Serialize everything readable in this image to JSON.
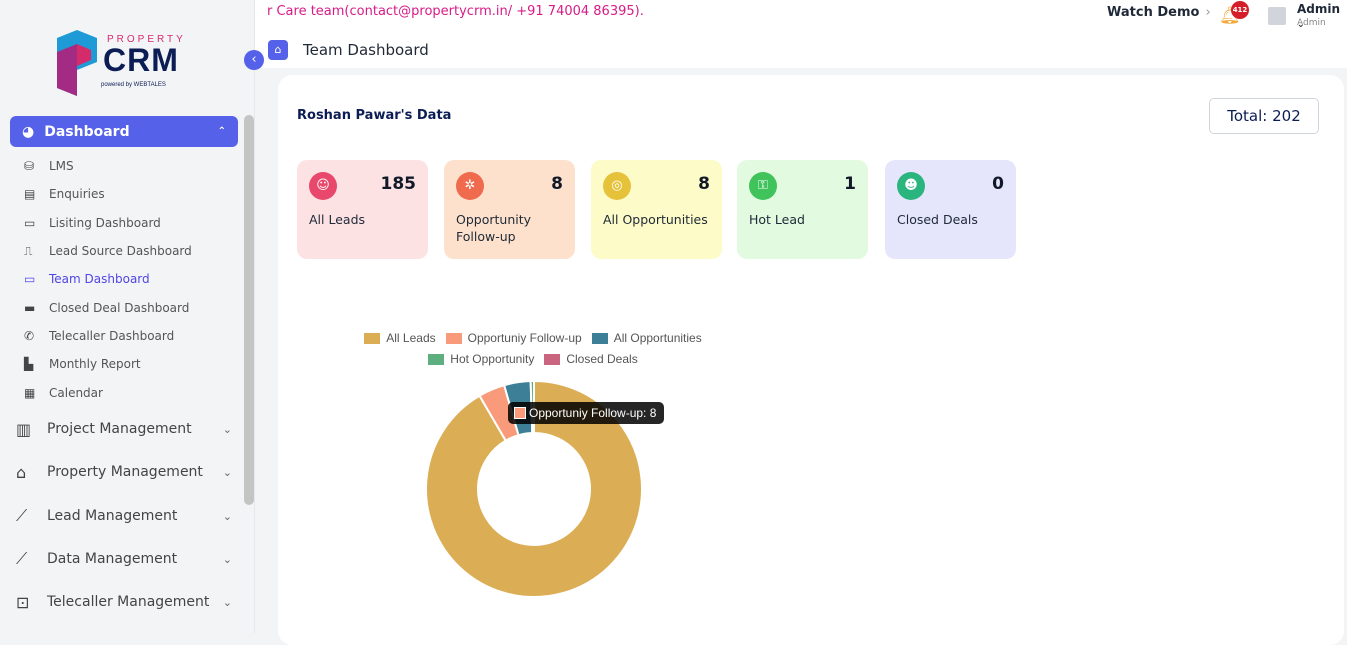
{
  "brand": {
    "top_text": "PROPERTY",
    "name": "CRM",
    "powered_by": "powered by WEBTALES"
  },
  "sidebar": {
    "dashboard_label": "Dashboard",
    "sub_items": [
      {
        "label": "LMS",
        "icon": "database-icon"
      },
      {
        "label": "Enquiries",
        "icon": "document-icon"
      },
      {
        "label": "Lisiting Dashboard",
        "icon": "monitor-icon"
      },
      {
        "label": "Lead Source Dashboard",
        "icon": "tv-icon"
      },
      {
        "label": "Team Dashboard",
        "icon": "screen-icon",
        "active": true
      },
      {
        "label": "Closed Deal Dashboard",
        "icon": "desktop-icon"
      },
      {
        "label": "Telecaller Dashboard",
        "icon": "phone-icon"
      },
      {
        "label": "Monthly Report",
        "icon": "file-icon"
      },
      {
        "label": "Calendar",
        "icon": "calendar-icon"
      }
    ],
    "groups": [
      {
        "label": "Project Management",
        "icon": "building-icon"
      },
      {
        "label": "Property Management",
        "icon": "house-icon"
      },
      {
        "label": "Lead Management",
        "icon": "chart-line-icon"
      },
      {
        "label": "Data Management",
        "icon": "chart-line-icon"
      },
      {
        "label": "Telecaller Management",
        "icon": "chat-icon"
      }
    ]
  },
  "header": {
    "marquee": "r Care team(contact@propertycrm.in/ +91 74004 86395).",
    "watch_demo": "Watch Demo",
    "notification_count": "412",
    "user_name": "Admin",
    "user_role": "Admin",
    "page_title": "Team Dashboard"
  },
  "main": {
    "title": "Roshan Pawar's Data",
    "total": "Total: 202",
    "stats": [
      {
        "label": "All Leads",
        "value": "185",
        "bg": "#fde2e4",
        "icon_bg": "#e8486b",
        "icon": "users-icon"
      },
      {
        "label": "Opportunity Follow-up",
        "value": "8",
        "bg": "#fde1cc",
        "icon_bg": "#f06a4e",
        "icon": "network-icon"
      },
      {
        "label": "All Opportunities",
        "value": "8",
        "bg": "#fdfbc8",
        "icon_bg": "#e6c23a",
        "icon": "target-icon"
      },
      {
        "label": "Hot Lead",
        "value": "1",
        "bg": "#e2fbe0",
        "icon_bg": "#3fc35a",
        "icon": "key-icon"
      },
      {
        "label": "Closed Deals",
        "value": "0",
        "bg": "#e5e6fb",
        "icon_bg": "#2bb57e",
        "icon": "handshake-icon"
      }
    ]
  },
  "chart_data": {
    "type": "pie",
    "categories": [
      "All Leads",
      "Opportuniy Follow-up",
      "All Opportunities",
      "Hot Opportunity",
      "Closed Deals"
    ],
    "values": [
      185,
      8,
      8,
      1,
      0
    ],
    "colors": [
      "#dbad55",
      "#f99a7a",
      "#3c7f96",
      "#5fae7f",
      "#c9657f"
    ],
    "legend_position": "top",
    "tooltip": "Opportuniy Follow-up: 8"
  }
}
